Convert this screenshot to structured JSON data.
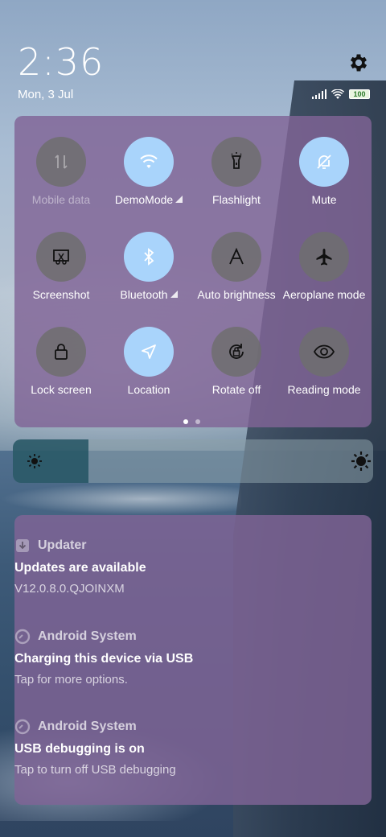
{
  "header": {
    "time": "2:36",
    "date": "Mon, 3 Jul",
    "battery_level": "100"
  },
  "quick_settings": {
    "tiles": [
      {
        "label": "Mobile data",
        "state": "disabled",
        "icon": "mobile-data-icon"
      },
      {
        "label": "DemoMode",
        "state": "on",
        "icon": "wifi-icon",
        "expandable": true
      },
      {
        "label": "Flashlight",
        "state": "off",
        "icon": "flashlight-icon"
      },
      {
        "label": "Mute",
        "state": "on",
        "icon": "bell-off-icon"
      },
      {
        "label": "Screenshot",
        "state": "off",
        "icon": "screenshot-icon"
      },
      {
        "label": "Bluetooth",
        "state": "on",
        "icon": "bluetooth-icon",
        "expandable": true
      },
      {
        "label": "Auto brightness",
        "state": "off",
        "icon": "auto-brightness-icon"
      },
      {
        "label": "Aeroplane mode",
        "state": "off",
        "icon": "airplane-icon"
      },
      {
        "label": "Lock screen",
        "state": "off",
        "icon": "lock-icon"
      },
      {
        "label": "Location",
        "state": "on",
        "icon": "location-arrow-icon"
      },
      {
        "label": "Rotate off",
        "state": "off",
        "icon": "rotate-lock-icon"
      },
      {
        "label": "Reading mode",
        "state": "off",
        "icon": "eye-icon"
      }
    ],
    "page_indicator": {
      "pages": 2,
      "current": 1
    }
  },
  "brightness": {
    "level_fraction": 0.21
  },
  "notifications": [
    {
      "app": "Updater",
      "icon": "updater-icon",
      "title": "Updates are available",
      "text": "V12.0.8.0.QJOINXM"
    },
    {
      "app": "Android System",
      "icon": "android-system-icon",
      "title": "Charging this device via USB",
      "text": "Tap for more options."
    },
    {
      "app": "Android System",
      "icon": "android-system-icon",
      "title": "USB debugging is on",
      "text": "Tap to turn off USB debugging"
    }
  ],
  "colors": {
    "tile_on": "#a9d4fb",
    "tile_off": "#6e6e6e",
    "panel": "#806496"
  }
}
